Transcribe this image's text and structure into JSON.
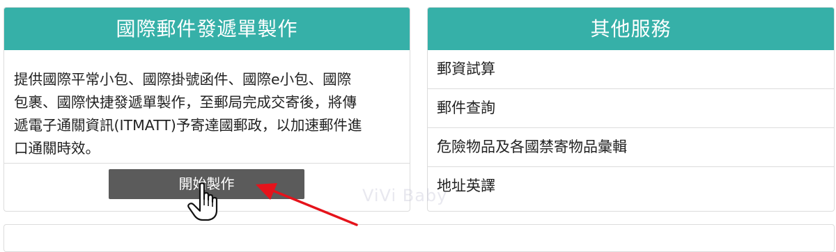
{
  "colors": {
    "header_bg": "#36b0a8",
    "button_bg": "#5b5b5b",
    "arrow": "#e5131b"
  },
  "left_card": {
    "title": "國際郵件發遞單製作",
    "desc_lines": [
      "提供國際平常小包、國際掛號函件、國際e小包、國際",
      "包裹、國際快捷發遞單製作，至郵局完成交寄後，將傳",
      "遞電子通關資訊(ITMATT)予寄達國郵政，以加速郵件進",
      "口通關時效。"
    ],
    "button_label": "開始製作"
  },
  "right_card": {
    "title": "其他服務",
    "items": [
      {
        "label": "郵資試算"
      },
      {
        "label": "郵件查詢"
      },
      {
        "label": "危險物品及各國禁寄物品彙輯"
      },
      {
        "label": "地址英譯"
      }
    ]
  },
  "watermark": "ViVi Baby",
  "icons": {
    "cursor": "hand-pointer-icon",
    "annotation": "red-arrow-icon"
  }
}
